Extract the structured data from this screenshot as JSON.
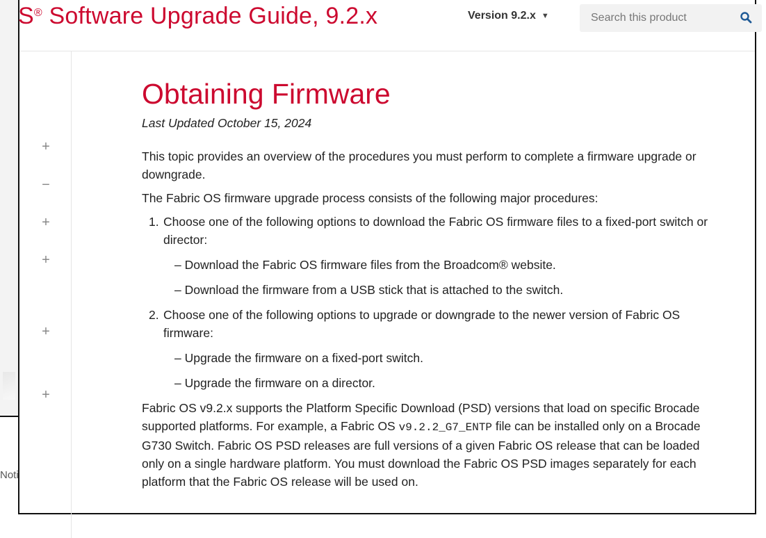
{
  "header": {
    "guide_title_prefix": "S",
    "guide_title_mark": "®",
    "guide_title": "Software Upgrade Guide, 9.2.x",
    "version_label": "Version 9.2.x",
    "search_placeholder": "Search this product"
  },
  "sidebar": {
    "toggles": [
      "+",
      "−",
      "+",
      "+",
      "+",
      "+"
    ]
  },
  "background": {
    "notice_label": "Notice"
  },
  "content": {
    "title": "Obtaining Firmware",
    "last_updated": "Last Updated October 15, 2024",
    "intro": "This topic provides an overview of the procedures you must perform to complete a firmware upgrade or downgrade.",
    "process_intro": "The Fabric OS firmware upgrade process consists of the following major procedures:",
    "steps": [
      {
        "number": "1.",
        "text": "Choose one of the following options to download the Fabric OS firmware files to a fixed-port switch or director:",
        "options": [
          "– Download the Fabric OS firmware files from the Broadcom® website.",
          "– Download the firmware from a USB stick that is attached to the switch."
        ]
      },
      {
        "number": "2.",
        "text": "Choose one of the following options to upgrade or downgrade to the newer version of Fabric OS firmware:",
        "options": [
          "– Upgrade the firmware on a fixed-port switch.",
          "– Upgrade the firmware on a director."
        ]
      }
    ],
    "psd_part1": "Fabric OS v9.2.x supports the Platform Specific Download (PSD) versions that load on specific Brocade supported platforms. For example, a Fabric OS ",
    "psd_code": "v9.2.2_G7_ENTP",
    "psd_part2": " file can be installed only on a Brocade G730 Switch. Fabric OS PSD releases are full versions of a given Fabric OS release that can be loaded only on a single hardware platform. You must download the Fabric OS PSD images separately for each platform that the Fabric OS release will be used on."
  },
  "colors": {
    "brand_red": "#cc092f",
    "search_icon": "#1f5a96"
  }
}
